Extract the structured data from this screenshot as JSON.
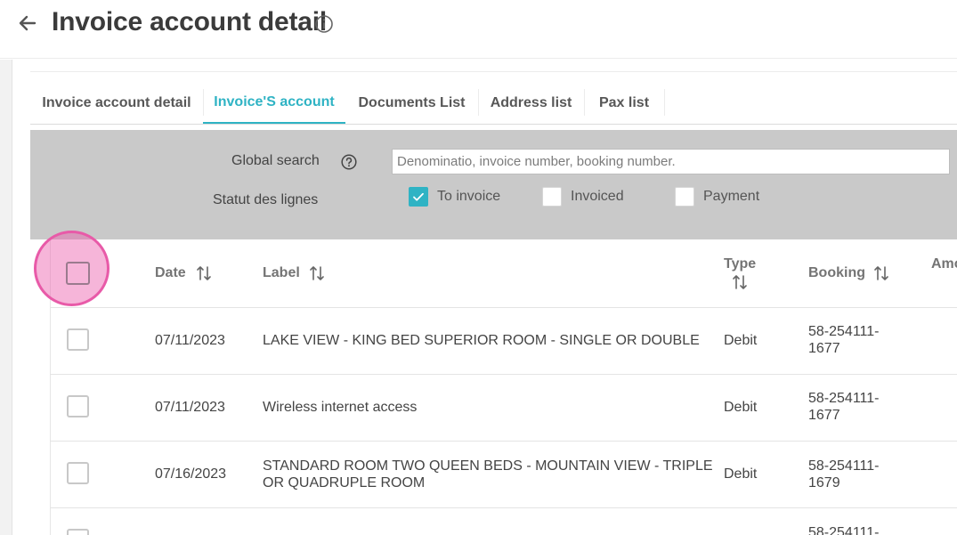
{
  "header": {
    "title": "Invoice account detail"
  },
  "tabs": [
    {
      "label": "Invoice account detail"
    },
    {
      "label": "Invoice'S account"
    },
    {
      "label": "Documents List"
    },
    {
      "label": "Address list"
    },
    {
      "label": "Pax list"
    }
  ],
  "active_tab": "Invoice'S account",
  "filters": {
    "global_search_label": "Global search",
    "search_placeholder": "Denominatio, invoice number, booking number.",
    "status_label": "Statut des lignes",
    "statuses": [
      {
        "label": "To invoice",
        "checked": true
      },
      {
        "label": "Invoiced",
        "checked": false
      },
      {
        "label": "Payment",
        "checked": false
      }
    ]
  },
  "table": {
    "columns": {
      "date": "Date",
      "label": "Label",
      "type": "Type",
      "booking": "Booking",
      "amount": "Amo"
    },
    "rows": [
      {
        "date": "07/11/2023",
        "label_1": "LAKE VIEW - KING BED SUPERIOR ROOM - SINGLE OR DOUBLE",
        "label_2": "",
        "type": "Debit",
        "booking_1": "58-254111-",
        "booking_2": "1677"
      },
      {
        "date": "07/11/2023",
        "label_1": "Wireless internet access",
        "label_2": "",
        "type": "Debit",
        "booking_1": "58-254111-",
        "booking_2": "1677"
      },
      {
        "date": "07/16/2023",
        "label_1": "STANDARD ROOM TWO QUEEN BEDS - MOUNTAIN VIEW - TRIPLE",
        "label_2": "OR QUADRUPLE ROOM",
        "type": "Debit",
        "booking_1": "58-254111-",
        "booking_2": "1679"
      },
      {
        "booking_1": "58-254111-"
      }
    ]
  },
  "colors": {
    "accent": "#2fb3c4",
    "filter_bg": "#c9c9c9",
    "highlight": "#e85aa8"
  }
}
